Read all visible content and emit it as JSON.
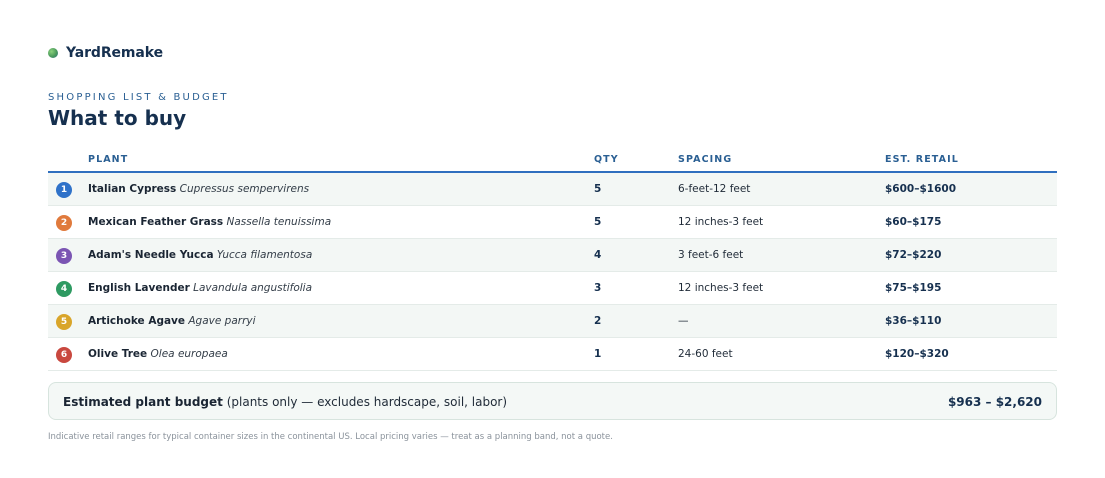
{
  "brand": {
    "name": "YardRemake"
  },
  "section": {
    "eyebrow": "SHOPPING LIST & BUDGET",
    "title": "What to buy"
  },
  "table": {
    "headers": {
      "plant": "PLANT",
      "qty": "QTY",
      "spacing": "SPACING",
      "retail": "EST. RETAIL"
    },
    "rows": [
      {
        "num": "1",
        "color": "#2f72c9",
        "common": "Italian Cypress",
        "scientific": "Cupressus sempervirens",
        "qty": "5",
        "spacing": "6-feet-12 feet",
        "retail": "$600–$1600"
      },
      {
        "num": "2",
        "color": "#e07a3c",
        "common": "Mexican Feather Grass",
        "scientific": "Nassella tenuissima",
        "qty": "5",
        "spacing": "12 inches-3 feet",
        "retail": "$60–$175"
      },
      {
        "num": "3",
        "color": "#7b55b3",
        "common": "Adam's Needle Yucca",
        "scientific": "Yucca filamentosa",
        "qty": "4",
        "spacing": "3 feet-6 feet",
        "retail": "$72–$220"
      },
      {
        "num": "4",
        "color": "#2e9a62",
        "common": "English Lavender",
        "scientific": "Lavandula angustifolia",
        "qty": "3",
        "spacing": "12 inches-3 feet",
        "retail": "$75–$195"
      },
      {
        "num": "5",
        "color": "#d9a52a",
        "common": "Artichoke Agave",
        "scientific": "Agave parryi",
        "qty": "2",
        "spacing": "—",
        "retail": "$36–$110"
      },
      {
        "num": "6",
        "color": "#c9483f",
        "common": "Olive Tree",
        "scientific": "Olea europaea",
        "qty": "1",
        "spacing": "24-60 feet",
        "retail": "$120–$320"
      }
    ]
  },
  "budget": {
    "label_bold": "Estimated plant budget",
    "label_note": "(plants only — excludes hardscape, soil, labor)",
    "total": "$963 – $2,620"
  },
  "footnote": "Indicative retail ranges for typical container sizes in the continental US. Local pricing varies — treat as a planning band, not a quote."
}
